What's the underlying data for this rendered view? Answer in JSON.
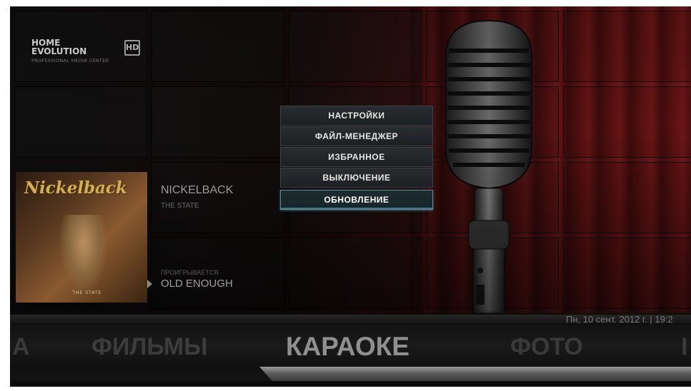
{
  "logo": {
    "brand": "HOME EVOLUTION",
    "hd_badge": "HD",
    "tagline": "PROFESSIONAL MEDIA CENTER"
  },
  "now_playing": {
    "album_band_text": "Nickelback",
    "album_caption": "THE STATE",
    "artist": "NICKELBACK",
    "album": "THE STATE",
    "status_label": "ПРОИГРЫВАЕТСЯ",
    "track": "OLD ENOUGH"
  },
  "menu": {
    "items": [
      {
        "label": "НАСТРОЙКИ",
        "selected": false
      },
      {
        "label": "ФАЙЛ-МЕНЕДЖЕР",
        "selected": false
      },
      {
        "label": "ИЗБРАННОЕ",
        "selected": false
      },
      {
        "label": "ВЫКЛЮЧЕНИЕ",
        "selected": false
      },
      {
        "label": "ОБНОВЛЕНИЕ",
        "selected": true
      }
    ]
  },
  "status_bar": {
    "datetime": "Пн, 10 сент. 2012 г. | 19:2"
  },
  "main_nav": {
    "prev_partial": "А",
    "films": "ФИЛЬМЫ",
    "current": "КАРАОКЕ",
    "photo": "ФОТО",
    "next_partial": "I"
  },
  "colors": {
    "background": "#0a0a0a",
    "curtain": "#6d1414",
    "menu_highlight": "#5a8a98",
    "nav_active": "#8f8f8f"
  }
}
